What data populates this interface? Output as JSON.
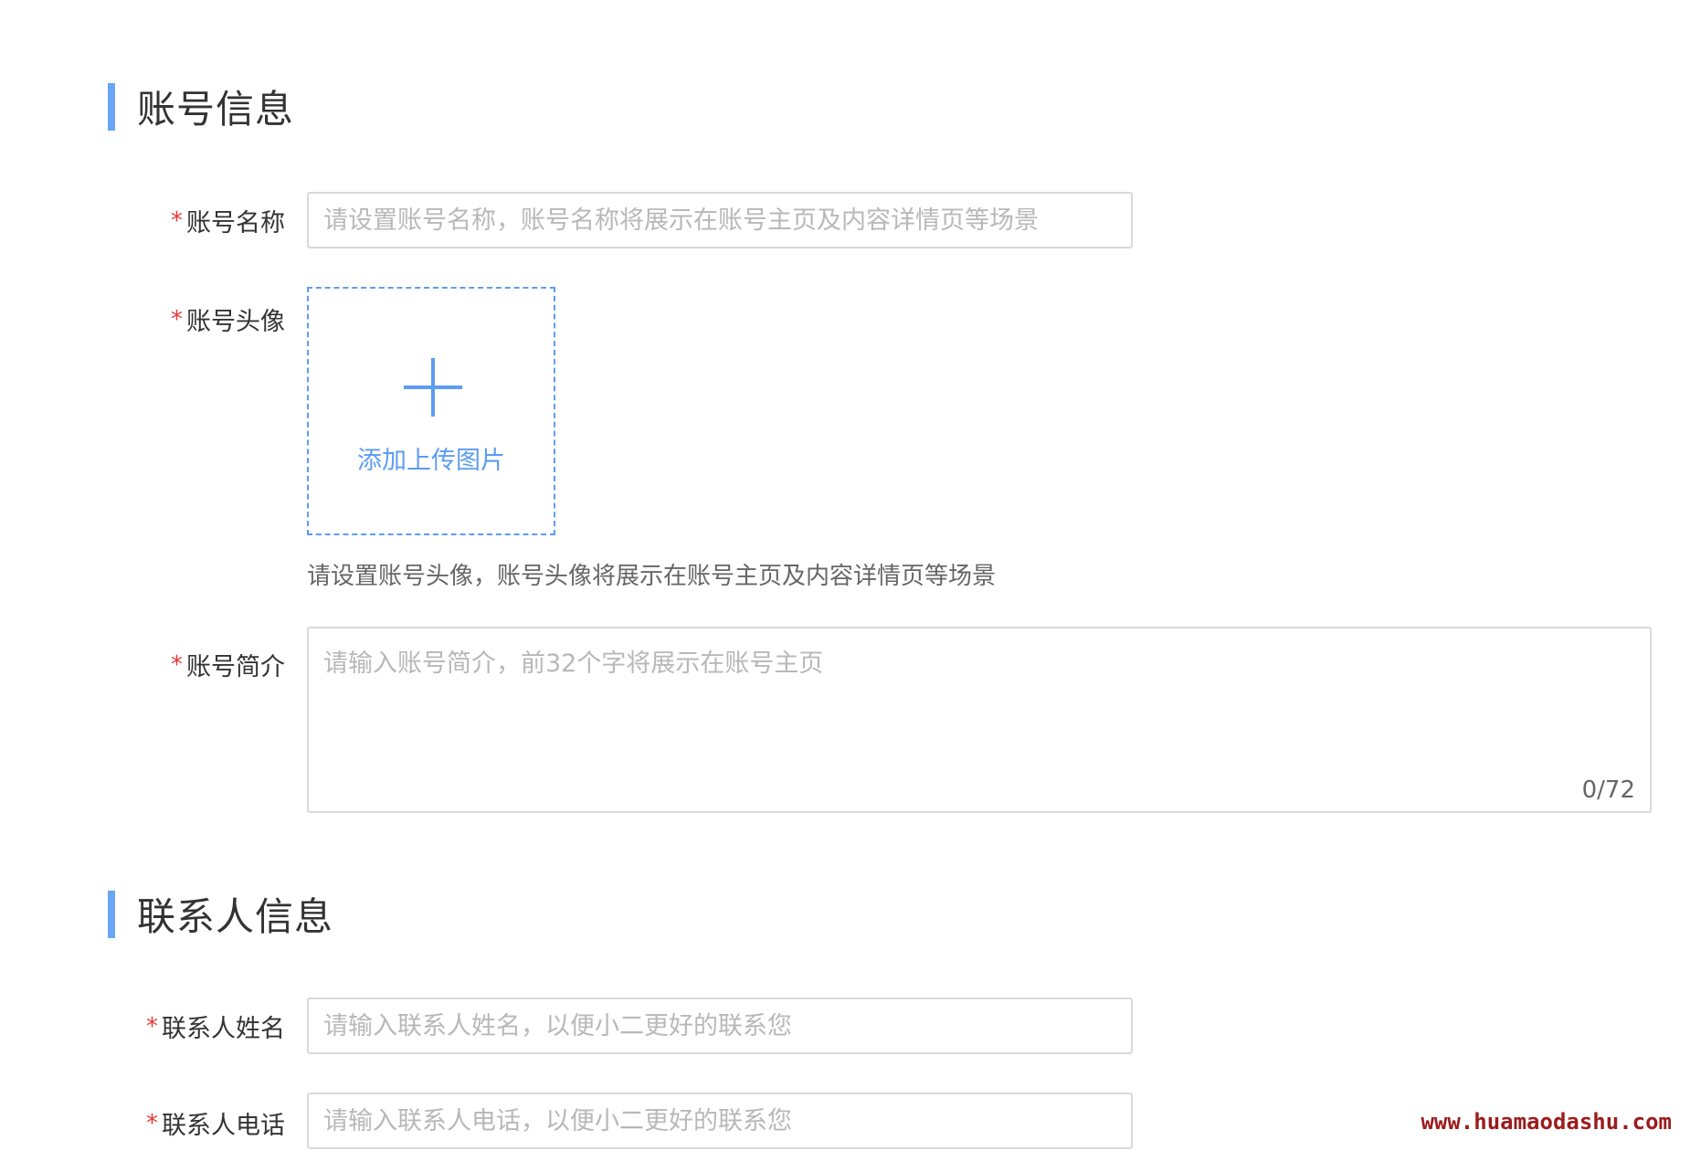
{
  "account_section": {
    "title": "账号信息",
    "accent_color": "#69a5f5"
  },
  "account_name": {
    "required_mark": "*",
    "label": "账号名称",
    "placeholder": "请设置账号名称，账号名称将展示在账号主页及内容详情页等场景",
    "value": ""
  },
  "account_avatar": {
    "required_mark": "*",
    "label": "账号头像",
    "upload_icon": "plus-icon",
    "upload_label": "添加上传图片",
    "helper": "请设置账号头像，账号头像将展示在账号主页及内容详情页等场景"
  },
  "account_intro": {
    "required_mark": "*",
    "label": "账号简介",
    "placeholder": "请输入账号简介，前32个字将展示在账号主页",
    "value": "",
    "counter": "0/72"
  },
  "contact_section": {
    "title": "联系人信息",
    "accent_color": "#69a5f5"
  },
  "contact_name": {
    "required_mark": "*",
    "label": "联系人姓名",
    "placeholder": "请输入联系人姓名，以便小二更好的联系您",
    "value": ""
  },
  "contact_phone": {
    "required_mark": "*",
    "label": "联系人电话",
    "placeholder": "请输入联系人电话，以便小二更好的联系您",
    "value": ""
  },
  "watermark": {
    "text": "www.huamaodashu.com"
  },
  "colors": {
    "required": "#e53935",
    "upload_accent": "#5d9cf3",
    "border": "#d9d9d9",
    "placeholder": "#b8b8b8"
  }
}
